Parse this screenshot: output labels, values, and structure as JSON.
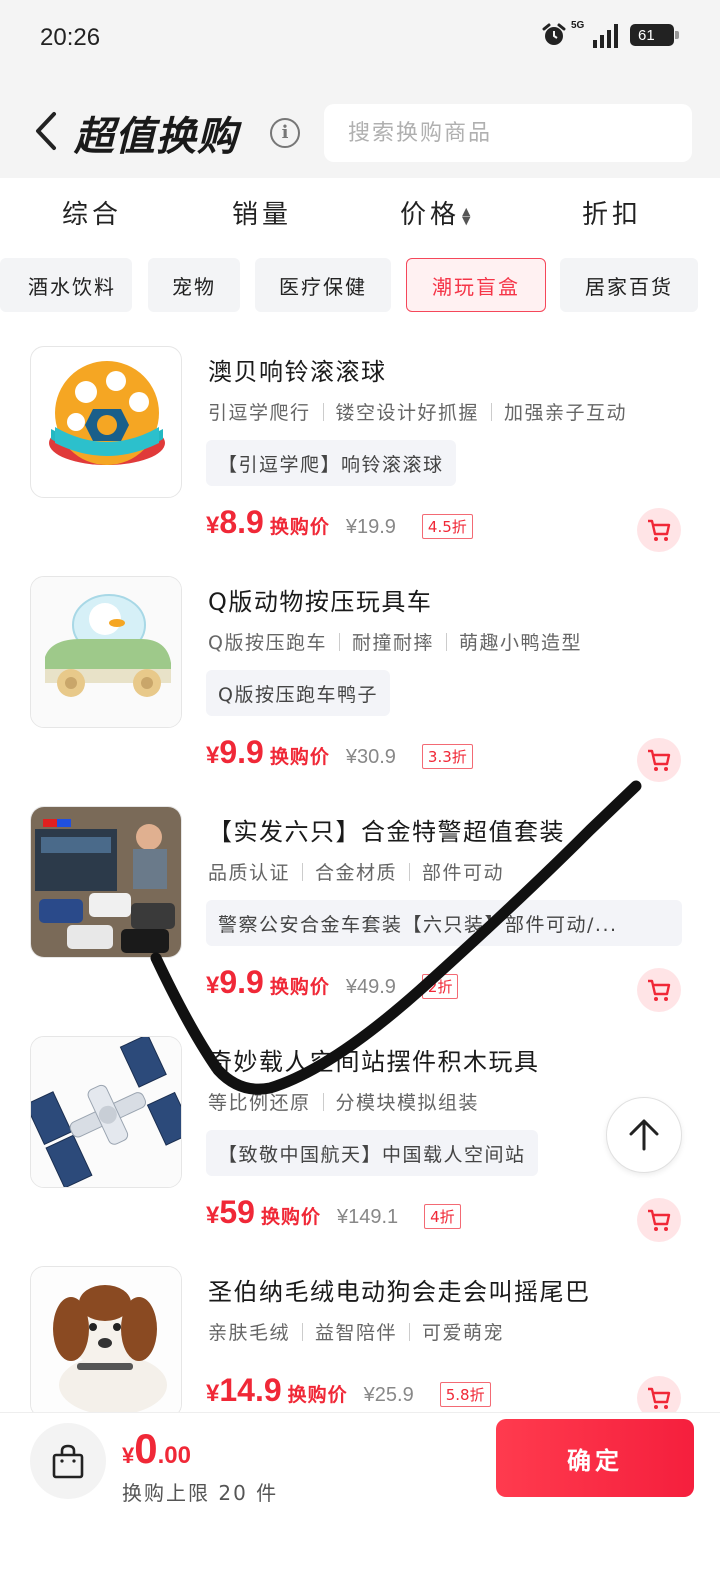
{
  "status": {
    "time": "20:26",
    "network": "5G",
    "battery": "61"
  },
  "header": {
    "title": "超值换购",
    "search_placeholder": "搜索换购商品"
  },
  "sort": [
    "综合",
    "销量",
    "价格",
    "折扣"
  ],
  "categories": [
    {
      "label": "酒水饮料"
    },
    {
      "label": "宠物"
    },
    {
      "label": "医疗保健"
    },
    {
      "label": "潮玩盲盒",
      "active": true
    },
    {
      "label": "居家百货"
    }
  ],
  "products": [
    {
      "title": "澳贝响铃滚滚球",
      "tags": [
        "引逗学爬行",
        "镂空设计好抓握",
        "加强亲子互动"
      ],
      "note": "【引逗学爬】响铃滚滚球",
      "yen": "¥",
      "price": "8.9",
      "price_label": "换购价",
      "original": "¥19.9",
      "discount": "4.5折"
    },
    {
      "title": "Q版动物按压玩具车",
      "tags": [
        "Q版按压跑车",
        "耐撞耐摔",
        "萌趣小鸭造型"
      ],
      "note": "Q版按压跑车鸭子",
      "yen": "¥",
      "price": "9.9",
      "price_label": "换购价",
      "original": "¥30.9",
      "discount": "3.3折"
    },
    {
      "title": "【实发六只】合金特警超值套装",
      "tags": [
        "品质认证",
        "合金材质",
        "部件可动"
      ],
      "note": "警察公安合金车套装【六只装】部件可动/...",
      "yen": "¥",
      "price": "9.9",
      "price_label": "换购价",
      "original": "¥49.9",
      "discount": "2折"
    },
    {
      "title": "奇妙载人空间站摆件积木玩具",
      "tags": [
        "等比例还原",
        "分模块模拟组装"
      ],
      "note": "【致敬中国航天】中国载人空间站",
      "yen": "¥",
      "price": "59",
      "price_label": "换购价",
      "original": "¥149.1",
      "discount": "4折"
    },
    {
      "title": "圣伯纳毛绒电动狗会走会叫摇尾巴",
      "tags": [
        "亲肤毛绒",
        "益智陪伴",
        "可爱萌宠"
      ],
      "note": "",
      "yen": "¥",
      "price": "14.9",
      "price_label": "换购价",
      "original": "¥25.9",
      "discount": "5.8折"
    }
  ],
  "footer": {
    "yen": "¥",
    "total_int": "0",
    "total_dec": ".00",
    "limit_text": "换购上限 20 件",
    "confirm_label": "确定"
  },
  "colors": {
    "accent": "#f02837",
    "accent_bg": "#ffe4e6",
    "chip_bg": "#f3f4f6"
  }
}
